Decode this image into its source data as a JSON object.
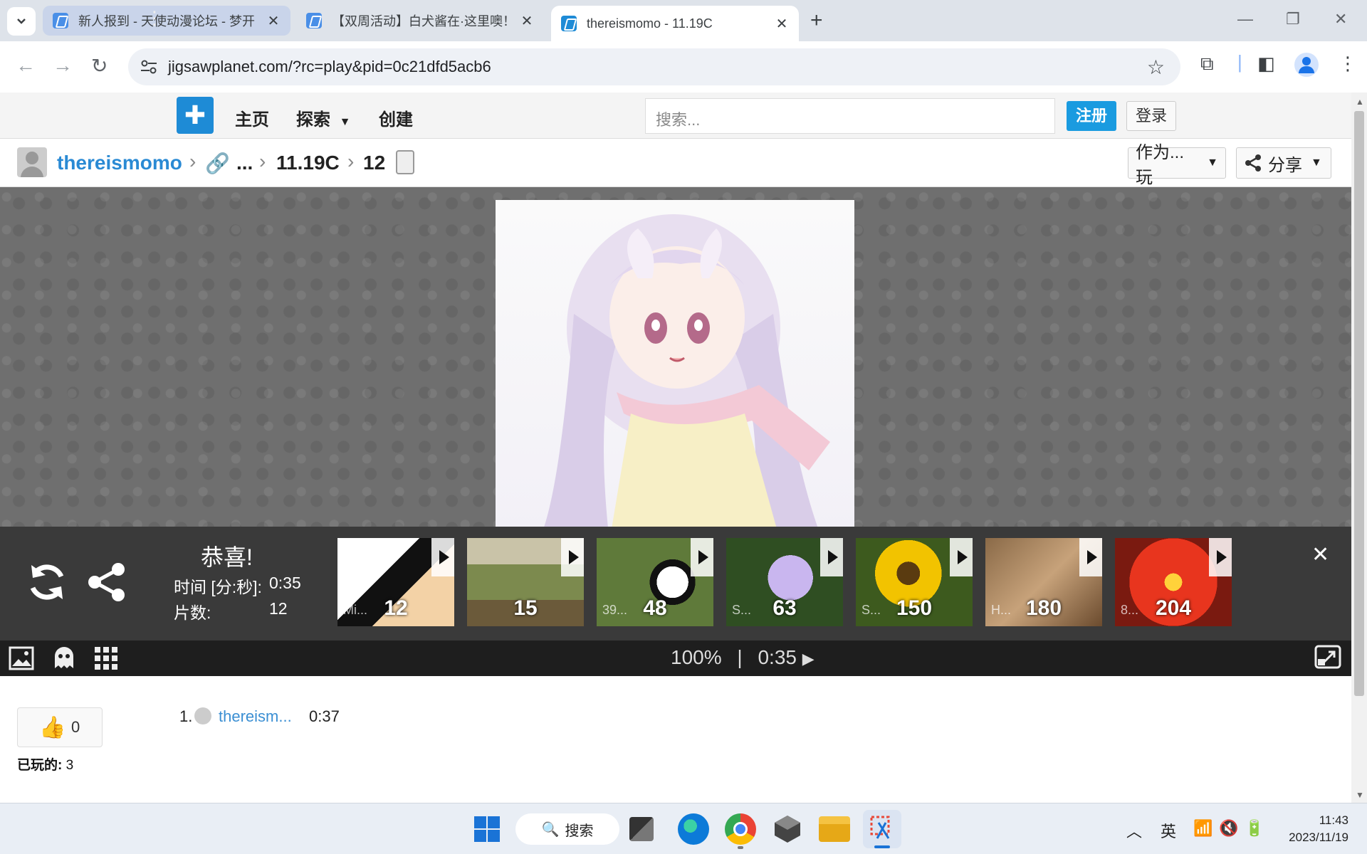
{
  "browser": {
    "tabs": [
      {
        "title": "新人报到 - 天使动漫论坛 - 梦开",
        "close": "✕"
      },
      {
        "title": "【双周活动】白犬酱在·这里噢！",
        "close": "✕"
      },
      {
        "title": "thereismomo - 11.19C",
        "close": "✕"
      }
    ],
    "new_tab": "+",
    "url": "jigsawplanet.com/?rc=play&pid=0c21dfd5acb6"
  },
  "site": {
    "nav": {
      "home": "主页",
      "explore": "探索",
      "create": "创建"
    },
    "search_placeholder": "搜索...",
    "register": "注册",
    "login": "登录"
  },
  "breadcrumb": {
    "user": "thereismomo",
    "ellipsis": "...",
    "folder": "11.19C",
    "pieces": "12",
    "play_as": "作为...玩",
    "share": "分享"
  },
  "overlay": {
    "congrats": "恭喜!",
    "time_label": "时间 [分:秒]:",
    "time_value": "0:35",
    "pieces_label": "片数:",
    "pieces_value": "12",
    "close": "✕",
    "thumbnails": [
      {
        "name": "Mi...",
        "count": "12"
      },
      {
        "name": "",
        "count": "15"
      },
      {
        "name": "39...",
        "count": "48"
      },
      {
        "name": "S...",
        "count": "63"
      },
      {
        "name": "S...",
        "count": "150"
      },
      {
        "name": "H...",
        "count": "180"
      },
      {
        "name": "8...",
        "count": "204"
      }
    ]
  },
  "toolbar": {
    "zoom": "100%",
    "separator": "|",
    "timer": "0:35"
  },
  "below": {
    "likes": "0",
    "played_label": "已玩的:",
    "played_value": "3",
    "leaderboard": [
      {
        "rank": "1.",
        "user": "thereism...",
        "time": "0:37"
      }
    ]
  },
  "taskbar": {
    "search": "搜索",
    "ime": "英",
    "time": "11:43",
    "date": "2023/11/19"
  },
  "colors": {
    "accent": "#1a9be0",
    "link": "#3b8fd3",
    "overlay": "#3a3a3a"
  }
}
